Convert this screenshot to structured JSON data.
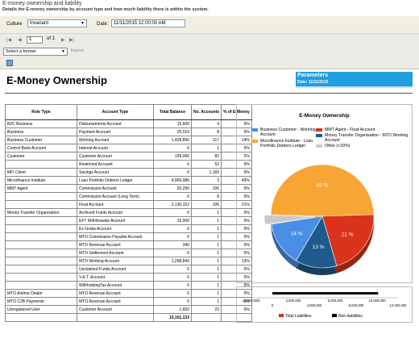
{
  "header": {
    "title": "E-money ownership and liability",
    "description": "Details the E-money ownership by account type and how much liability there is within the system."
  },
  "params": {
    "culture_label": "Culture",
    "culture_value": "Invariant",
    "date_label": "Date:",
    "date_value": "11/11/2015 12:00:00 AM"
  },
  "toolbar": {
    "page_value": "1",
    "page_of": "of 1",
    "format_placeholder": "Select a format",
    "export_label": "Export"
  },
  "report": {
    "title": "E-Money Ownership",
    "params_heading": "Parameters",
    "params_date": "Date: 11/11/2015"
  },
  "table": {
    "headers": [
      "Role Type",
      "Account Type",
      "Total Balance",
      "No. Accounts",
      "% of E-Money"
    ],
    "rows": [
      [
        "B2C Business",
        "Disbursements Account",
        "15,600",
        "4",
        "0%"
      ],
      [
        "Business",
        "Payment Account",
        "25,010",
        "8",
        "0%"
      ],
      [
        "Business Customer",
        "Working Account",
        "1,428,890",
        "117",
        "14%"
      ],
      [
        "Control Bank Account",
        "Interest Account",
        "0",
        "1",
        "0%"
      ],
      [
        "Customer",
        "Customer Account",
        "199,066",
        "82",
        "2%"
      ],
      [
        "",
        "Restricted Account",
        "0",
        "52",
        "0%"
      ],
      [
        "MFI Client",
        "Savings Account",
        "0",
        "1,169",
        "0%"
      ],
      [
        "Microfinance Institute",
        "Loan Portfolio Debtors Ledger",
        "4,966,086",
        "3",
        "49%"
      ],
      [
        "MMT Agent",
        "Commission Account",
        "20,290",
        "106",
        "0%"
      ],
      [
        "",
        "Commission Account (Long Term)",
        "0",
        "8",
        "0%"
      ],
      [
        "",
        "Float Account",
        "2,130,152",
        "106",
        "21%"
      ],
      [
        "Money Transfer Organisation",
        "Archived Funds Account",
        "0",
        "1",
        "0%"
      ],
      [
        "",
        "EFT Withdrawals Account",
        "15,000",
        "1",
        "0%"
      ],
      [
        "",
        "Ex Gratia Account",
        "0",
        "1",
        "0%"
      ],
      [
        "",
        "MTO Commission Payable Account",
        "0",
        "1",
        "0%"
      ],
      [
        "",
        "MTO Revenue Account",
        "340",
        "1",
        "0%"
      ],
      [
        "",
        "MTO Settlement Account",
        "0",
        "1",
        "0%"
      ],
      [
        "",
        "MTO Working Account",
        "1,298,849",
        "1",
        "13%"
      ],
      [
        "",
        "Unclaimed Funds Account",
        "0",
        "1",
        "0%"
      ],
      [
        "",
        "V.A.T. Account",
        "0",
        "1",
        "0%"
      ],
      [
        "",
        "WithholdingTax Account",
        "0",
        "1",
        "0%"
      ],
      [
        "MTO Airtime Dealer",
        "MTO Revenue Account",
        "0",
        "1",
        "0%"
      ],
      [
        "MTO C2B Payments",
        "MTO Revenue Account",
        "0",
        "1",
        "0%"
      ],
      [
        "Unregistered User",
        "Customer Account",
        "1,650",
        "23",
        "0%"
      ]
    ],
    "total": "10,101,133"
  },
  "chart_data": [
    {
      "type": "pie",
      "title": "E-Money Ownership",
      "categories": [
        "Microfinance Institute - Loan Portfolio Debtors Ledger",
        "MMT Agent - Float Account",
        "Money Transfer Organisation - MTO Working Account",
        "Business Customer - Working Account",
        "Other (<20%)"
      ],
      "values": [
        49,
        21,
        13,
        14,
        3
      ],
      "labels": [
        "49 %",
        "21 %",
        "13 %",
        "14 %",
        ""
      ],
      "colors": [
        "#f7a535",
        "#d9331b",
        "#1e5b8c",
        "#4a8fe6",
        "#c9c9c9"
      ]
    },
    {
      "type": "bar",
      "categories": [
        "Total Liabilities",
        "Non-liabilities"
      ],
      "values": [
        10101133,
        0
      ],
      "colors": [
        "#d9331b",
        "#000000"
      ],
      "xlim": [
        -2000000,
        12000000
      ],
      "ticks": [
        "(2,000,000)",
        "0",
        "2,000,000",
        "4,000,000",
        "6,000,000",
        "8,000,000",
        "10,000,000",
        "12,000,000"
      ]
    }
  ],
  "legend": [
    {
      "label": "Business Customer - Working Account",
      "color": "#4a8fe6"
    },
    {
      "label": "MMT Agent - Float Account",
      "color": "#d9331b"
    },
    {
      "label": "Microfinance Institute - Loan Portfolio Debtors Ledger",
      "color": "#f7a535"
    },
    {
      "label": "Money Transfer Organisation - MTO Working Account",
      "color": "#1e5b8c"
    },
    {
      "label": "Other (<20%)",
      "color": "#c9c9c9"
    }
  ],
  "bar_legend": [
    {
      "label": "Total Liabilities",
      "color": "#d9331b"
    },
    {
      "label": "Non-liabilities",
      "color": "#000000"
    }
  ]
}
